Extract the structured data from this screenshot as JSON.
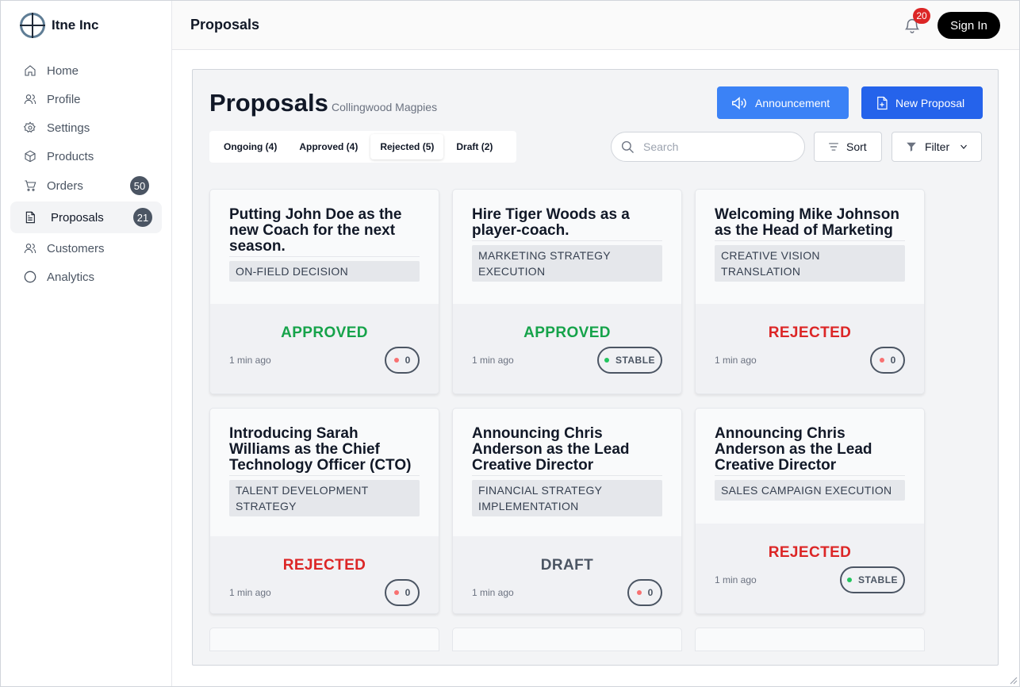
{
  "brand": {
    "name": "Itne Inc",
    "logo_icon": "crosshair-logo"
  },
  "sidebar": {
    "items": [
      {
        "label": "Home",
        "icon": "home-icon"
      },
      {
        "label": "Profile",
        "icon": "users-icon"
      },
      {
        "label": "Settings",
        "icon": "gear-icon"
      },
      {
        "label": "Products",
        "icon": "box-icon"
      },
      {
        "label": "Orders",
        "icon": "cart-icon",
        "badge": "50"
      },
      {
        "label": "Proposals",
        "icon": "document-icon",
        "badge": "21",
        "active": true
      },
      {
        "label": "Customers",
        "icon": "users-icon"
      },
      {
        "label": "Analytics",
        "icon": "circle-icon"
      }
    ]
  },
  "header": {
    "title": "Proposals",
    "notifications_count": "20",
    "signin_label": "Sign In"
  },
  "main": {
    "title": "Proposals",
    "subtitle": "Collingwood Magpies",
    "announcement_label": "Announcement",
    "new_proposal_label": "New Proposal",
    "tabs": [
      {
        "label": "Ongoing (4)"
      },
      {
        "label": "Approved (4)"
      },
      {
        "label": "Rejected (5)",
        "active": true
      },
      {
        "label": "Draft (2)"
      }
    ],
    "search": {
      "placeholder": "Search",
      "value": ""
    },
    "sort_label": "Sort",
    "filter_label": "Filter",
    "cards": [
      {
        "title": "Putting John Doe as the new Coach for the next season.",
        "tag": "ON-FIELD DECISION",
        "status": "APPROVED",
        "time": "1 min ago",
        "pill": "0",
        "pill_dot": "red"
      },
      {
        "title": "Hire Tiger Woods as a player-coach.",
        "tag": "MARKETING STRATEGY EXECUTION",
        "status": "APPROVED",
        "time": "1 min ago",
        "pill": "STABLE",
        "pill_dot": "green"
      },
      {
        "title": "Welcoming Mike Johnson as the Head of Marketing",
        "tag": "CREATIVE VISION TRANSLATION",
        "status": "REJECTED",
        "time": "1 min ago",
        "pill": "0",
        "pill_dot": "red"
      },
      {
        "title": "Introducing Sarah Williams as the Chief Technology Officer (CTO)",
        "tag": "TALENT DEVELOPMENT STRATEGY",
        "status": "REJECTED",
        "time": "1 min ago",
        "pill": "0",
        "pill_dot": "red"
      },
      {
        "title": "Announcing Chris Anderson as the Lead Creative Director",
        "tag": "FINANCIAL STRATEGY IMPLEMENTATION",
        "status": "DRAFT",
        "time": "1 min ago",
        "pill": "0",
        "pill_dot": "red"
      },
      {
        "title": "Announcing Chris Anderson as the Lead Creative Director",
        "tag": "SALES CAMPAIGN EXECUTION",
        "status": "REJECTED",
        "time": "1 min ago",
        "pill": "STABLE",
        "pill_dot": "green"
      }
    ]
  },
  "colors": {
    "primary": "#3b82f6",
    "primary_dark": "#2563eb",
    "approved": "#16a34a",
    "rejected": "#dc2626",
    "draft": "#4b5563",
    "badge_red": "#dc2626"
  }
}
